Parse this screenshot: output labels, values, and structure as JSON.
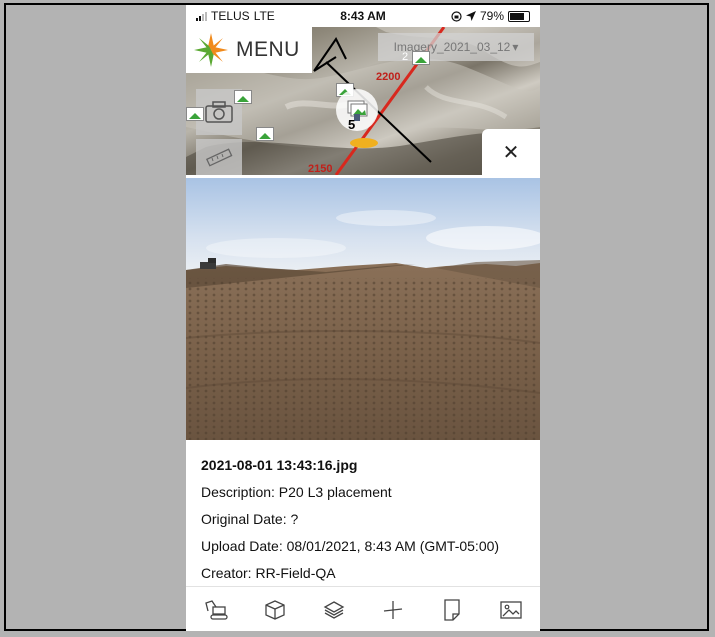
{
  "status_bar": {
    "carrier": "TELUS",
    "network": "LTE",
    "time": "8:43 AM",
    "battery": "79%"
  },
  "map": {
    "menu_label": "MENU",
    "imagery_label": "Imagery_2021_03_12",
    "cluster_count": "5",
    "thumb_count": "2",
    "station_upper": "2200",
    "station_lower": "2150",
    "close_icon": "✕"
  },
  "photo_info": {
    "filename": "2021-08-01 13:43:16.jpg",
    "description": "Description: P20 L3 placement",
    "original_date": "Original Date: ?",
    "upload_date": "Upload Date: 08/01/2021, 8:43 AM (GMT-05:00)",
    "creator": "Creator: RR-Field-QA"
  },
  "bottom_bar": {
    "items": [
      "excavator-icon",
      "box-3d-icon",
      "layers-icon",
      "survey-point-icon",
      "document-icon",
      "image-icon"
    ]
  },
  "colors": {
    "logo_orange": "#f08a1c",
    "logo_green": "#5aa832",
    "alignment_red": "#d8281e",
    "backdrop": "#b3b3b3"
  }
}
